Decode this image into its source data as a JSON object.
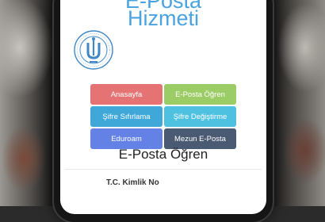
{
  "app": {
    "title_line1": "E-Posta",
    "title_line2": "Hizmeti"
  },
  "logo": {
    "icon": "university-seal-icon",
    "accent": "#3f87c6"
  },
  "menu": {
    "buttons": [
      {
        "label": "Anasayfa",
        "color": "#e57373"
      },
      {
        "label": "E-Posta Öğren",
        "color": "#9ccc65"
      },
      {
        "label": "Şifre Sıfırlama",
        "color": "#3fa8d8"
      },
      {
        "label": "Şifre Değiştirme",
        "color": "#4fc1e0"
      },
      {
        "label": "Eduroam",
        "color": "#6481e6"
      },
      {
        "label": "Mezun E-Posta",
        "color": "#4a5a72"
      }
    ]
  },
  "form": {
    "section_title": "E-Posta Öğren",
    "tc_label": "T.C. Kimlik No"
  }
}
